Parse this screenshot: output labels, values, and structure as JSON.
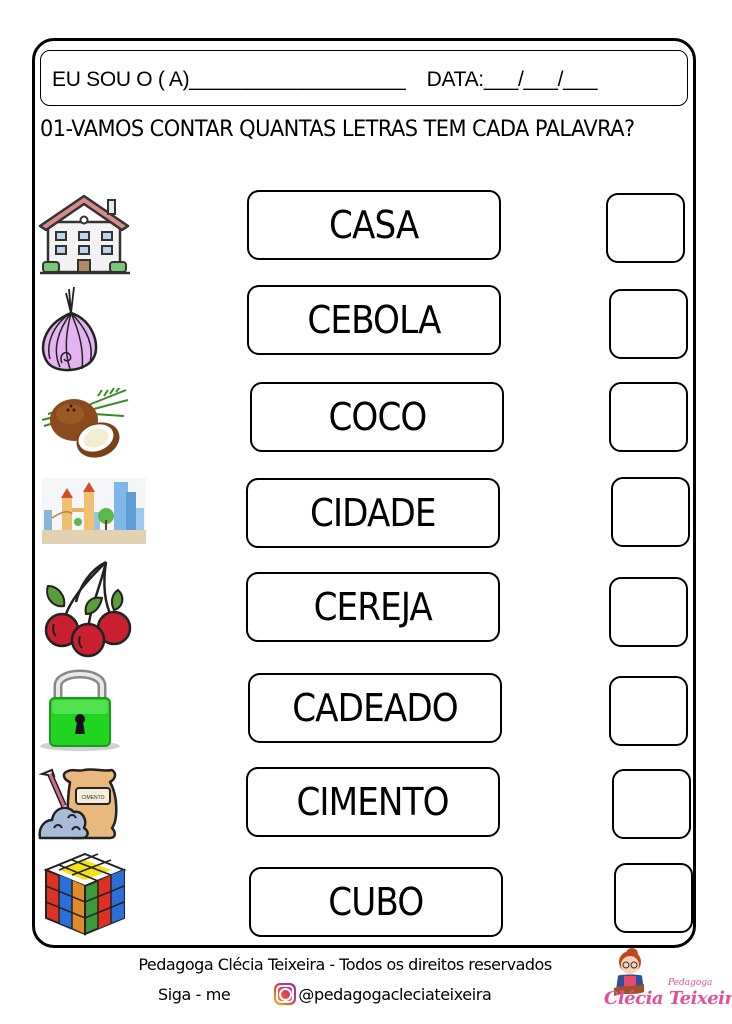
{
  "header": {
    "name_label": "EU SOU O ( A)___________________",
    "date_label": "DATA:___/___/___"
  },
  "question": {
    "text": "01-VAMOS CONTAR QUANTAS LETRAS TEM CADA PALAVRA?"
  },
  "items": [
    {
      "word": "CASA",
      "icon": "house-icon",
      "answer": ""
    },
    {
      "word": "CEBOLA",
      "icon": "onion-icon",
      "answer": ""
    },
    {
      "word": "COCO",
      "icon": "coconut-icon",
      "answer": ""
    },
    {
      "word": "CIDADE",
      "icon": "city-icon",
      "answer": ""
    },
    {
      "word": "CEREJA",
      "icon": "cherry-icon",
      "answer": ""
    },
    {
      "word": "CADEADO",
      "icon": "padlock-icon",
      "answer": ""
    },
    {
      "word": "CIMENTO",
      "icon": "cement-bag-icon",
      "answer": ""
    },
    {
      "word": "CUBO",
      "icon": "rubiks-cube-icon",
      "answer": ""
    }
  ],
  "cement_label": "CIMENTO",
  "footer": {
    "copyright": "Pedagoga Clécia Teixeira - Todos os direitos reservados",
    "follow": "Siga - me",
    "handle": "@pedagogacleciateixeira",
    "logo_small": "Pedagoga",
    "logo_name": "Clécia Teixeira"
  },
  "colors": {
    "border": "#000000",
    "logo_pink": "#e0529c",
    "padlock_green": "#22d422"
  }
}
